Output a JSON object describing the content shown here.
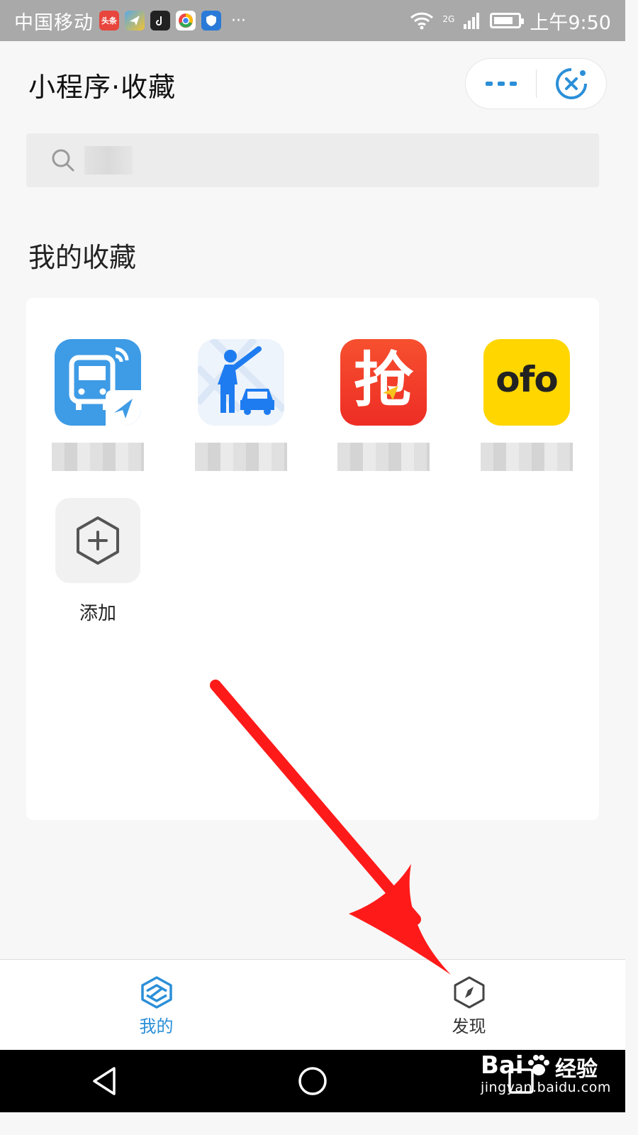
{
  "status_bar": {
    "carrier": "中国移动",
    "toutiao_badge": "头条",
    "network": "2G",
    "time": "上午9:50",
    "battery_level": 0.8,
    "notification_icons": [
      "toutiao-icon",
      "maps-icon",
      "tiktok-icon",
      "chrome-icon",
      "shield-icon"
    ]
  },
  "header": {
    "title": "小程序·收藏"
  },
  "search": {
    "placeholder": ""
  },
  "favorites": {
    "section_title": "我的收藏",
    "apps": [
      {
        "icon": "bus-app-icon",
        "name": ""
      },
      {
        "icon": "taxi-app-icon",
        "name": ""
      },
      {
        "icon": "grab-app-icon",
        "icon_text": "抢",
        "name": ""
      },
      {
        "icon": "ofo-app-icon",
        "icon_text": "ofo",
        "name": ""
      }
    ],
    "add_label": "添加"
  },
  "tabs": [
    {
      "label": "我的",
      "icon": "mine-icon",
      "active": true
    },
    {
      "label": "发现",
      "icon": "compass-icon",
      "active": false
    }
  ],
  "watermark": {
    "logo": "Bai",
    "suffix": "经验",
    "url": "jingyan.baidu.com"
  },
  "colors": {
    "accent": "#2b8fd8",
    "arrow": "#ff1a1a",
    "bus_icon": "#3e9be6",
    "grab_icon": "#f13a2c",
    "ofo_icon": "#ffd600"
  }
}
